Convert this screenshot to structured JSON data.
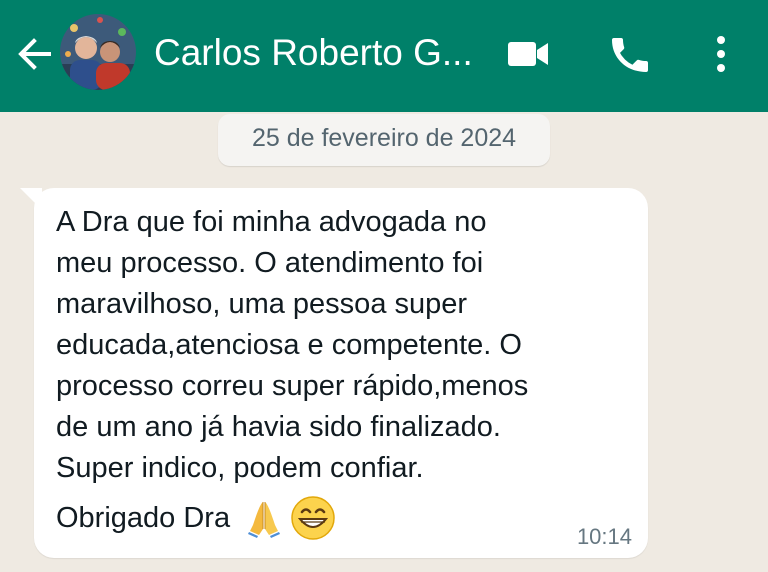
{
  "header": {
    "contact_name": "Carlos Roberto G...",
    "back_icon": "arrow-left-icon",
    "video_icon": "video-camera-icon",
    "call_icon": "phone-icon",
    "menu_icon": "more-vert-icon",
    "background_color": "#008069"
  },
  "chat": {
    "date_label": "25 de fevereiro de 2024",
    "message": {
      "text": "A Dra que foi minha advogada no\nmeu processo. O atendimento foi\nmaravilhoso, uma pessoa super\neducada,atenciosa e competente. O\nprocesso correu super rápido,menos\nde  um ano já havia sido finalizado.\nSuper indico, podem confiar.",
      "signoff": "Obrigado Dra",
      "emojis": [
        "folded-hands-emoji",
        "grinning-face-emoji"
      ],
      "time": "10:14"
    },
    "background_color": "#efeae2"
  }
}
